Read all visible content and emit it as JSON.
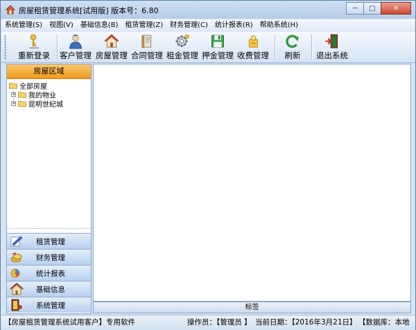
{
  "window": {
    "title": "房屋租赁管理系统[试用版]   版本号：6.80",
    "minimize_symbol": "─",
    "maximize_symbol": "□",
    "close_symbol": "✕"
  },
  "menubar": [
    "系统管理(S)",
    "视图(V)",
    "基础信息(B)",
    "租赁管理(Z)",
    "财务管理(C)",
    "统计报表(R)",
    "帮助系统(H)"
  ],
  "toolbar": [
    {
      "label": "重新登录",
      "icon": "key-user-icon"
    },
    {
      "label": "客户管理",
      "icon": "customer-icon"
    },
    {
      "label": "房屋管理",
      "icon": "house-icon"
    },
    {
      "label": "合同管理",
      "icon": "contract-icon"
    },
    {
      "label": "租金管理",
      "icon": "gear-rent-icon"
    },
    {
      "label": "押金管理",
      "icon": "floppy-deposit-icon"
    },
    {
      "label": "收费管理",
      "icon": "charge-icon"
    },
    {
      "label": "刷新",
      "icon": "refresh-icon"
    },
    {
      "label": "退出系统",
      "icon": "exit-door-icon"
    }
  ],
  "left_panel": {
    "header": "房屋区域",
    "tree": {
      "root": "全部房屋",
      "children": [
        "我的物业",
        "昆明世纪城"
      ],
      "expander": "+"
    },
    "nav": [
      {
        "label": "租赁管理",
        "icon": "lease-icon"
      },
      {
        "label": "财务管理",
        "icon": "finance-icon"
      },
      {
        "label": "统计报表",
        "icon": "report-icon"
      },
      {
        "label": "基础信息",
        "icon": "basic-info-icon"
      },
      {
        "label": "系统管理",
        "icon": "system-icon"
      }
    ]
  },
  "content": {
    "tag_bar": "标签"
  },
  "statusbar": {
    "product": "【房屋租赁管理系统试用客户】专用软件",
    "operator": "操作员：【管理员 】",
    "date": "当前日期：【2016年3月21日】",
    "database": "【数据库：本地"
  },
  "colors": {
    "header_orange": "#f29a1c",
    "nav_blue": "#b8d0ee",
    "window_blue": "#bdd3ec"
  }
}
